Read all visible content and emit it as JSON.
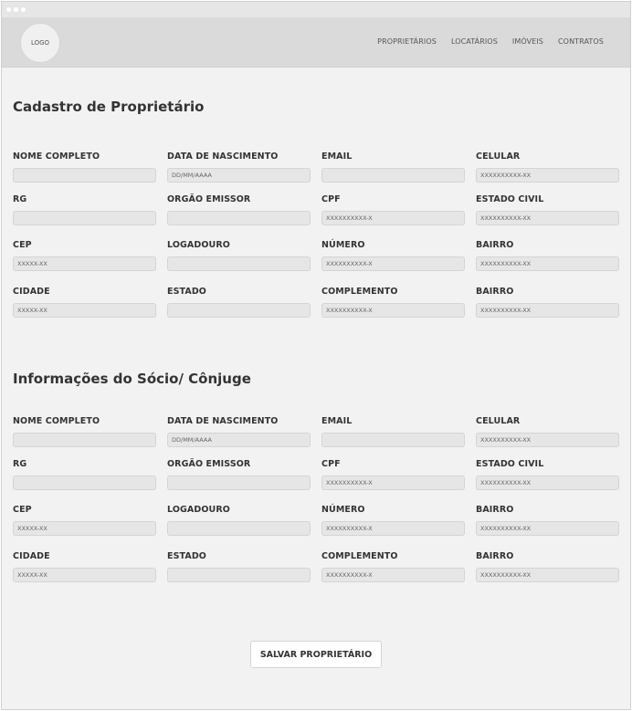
{
  "logo": "LOGO",
  "nav": [
    "PROPRIETÁRIOS",
    "LOCATÁRIOS",
    "IMÓVEIS",
    "CONTRATOS"
  ],
  "section1": {
    "title": "Cadastro de Proprietário",
    "fields": [
      {
        "label": "NOME COMPLETO",
        "value": ""
      },
      {
        "label": "DATA DE NASCIMENTO",
        "value": "DD/MM/AAAA"
      },
      {
        "label": "EMAIL",
        "value": ""
      },
      {
        "label": "CELULAR",
        "value": "XXXXXXXXXX-XX"
      },
      {
        "label": "RG",
        "value": ""
      },
      {
        "label": "ORGÃO EMISSOR",
        "value": ""
      },
      {
        "label": "CPF",
        "value": "XXXXXXXXXX-X"
      },
      {
        "label": "ESTADO CIVIL",
        "value": "XXXXXXXXXX-XX"
      },
      {
        "label": "CEP",
        "value": "XXXXX-XX"
      },
      {
        "label": "LOGADOURO",
        "value": ""
      },
      {
        "label": "NÚMERO",
        "value": "XXXXXXXXXX-X"
      },
      {
        "label": "BAIRRO",
        "value": "XXXXXXXXXX-XX"
      },
      {
        "label": "CIDADE",
        "value": "XXXXX-XX"
      },
      {
        "label": "ESTADO",
        "value": ""
      },
      {
        "label": "COMPLEMENTO",
        "value": "XXXXXXXXXX-X"
      },
      {
        "label": "BAIRRO",
        "value": "XXXXXXXXXX-XX"
      }
    ]
  },
  "section2": {
    "title": "Informações do Sócio/ Cônjuge",
    "fields": [
      {
        "label": "NOME COMPLETO",
        "value": ""
      },
      {
        "label": "DATA DE NASCIMENTO",
        "value": "DD/MM/AAAA"
      },
      {
        "label": "EMAIL",
        "value": ""
      },
      {
        "label": "CELULAR",
        "value": "XXXXXXXXXX-XX"
      },
      {
        "label": "RG",
        "value": ""
      },
      {
        "label": "ORGÃO EMISSOR",
        "value": ""
      },
      {
        "label": "CPF",
        "value": "XXXXXXXXXX-X"
      },
      {
        "label": "ESTADO CIVIL",
        "value": "XXXXXXXXXX-XX"
      },
      {
        "label": "CEP",
        "value": "XXXXX-XX"
      },
      {
        "label": "LOGADOURO",
        "value": ""
      },
      {
        "label": "NÚMERO",
        "value": "XXXXXXXXXX-X"
      },
      {
        "label": "BAIRRO",
        "value": "XXXXXXXXXX-XX"
      },
      {
        "label": "CIDADE",
        "value": "XXXXX-XX"
      },
      {
        "label": "ESTADO",
        "value": ""
      },
      {
        "label": "COMPLEMENTO",
        "value": "XXXXXXXXXX-X"
      },
      {
        "label": "BAIRRO",
        "value": "XXXXXXXXXX-XX"
      }
    ]
  },
  "save_label": "SALVAR PROPRIETÁRIO"
}
